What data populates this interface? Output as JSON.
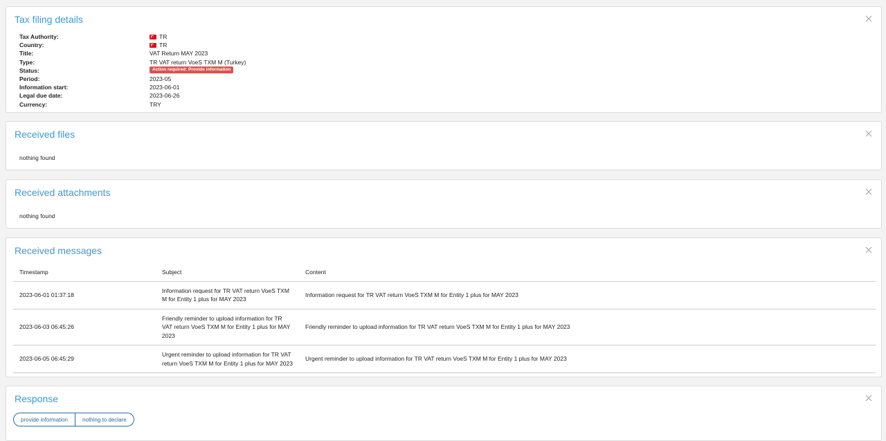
{
  "tax_filing": {
    "title": "Tax filing details",
    "rows": [
      {
        "label": "Tax Authority:",
        "value": "TR",
        "flag": true
      },
      {
        "label": "Country:",
        "value": "TR",
        "flag": true
      },
      {
        "label": "Title:",
        "value": "VAT Return MAY 2023"
      },
      {
        "label": "Type:",
        "value": "TR VAT return VoeS TXM M (Turkey)"
      },
      {
        "label": "Status:",
        "value": "Action required: Provide information",
        "badge": true
      },
      {
        "label": "Period:",
        "value": "2023-05"
      },
      {
        "label": "Information start:",
        "value": "2023-06-01"
      },
      {
        "label": "Legal due date:",
        "value": "2023-06-26"
      },
      {
        "label": "Currency:",
        "value": "TRY"
      }
    ]
  },
  "received_files": {
    "title": "Received files",
    "empty_text": "nothing found"
  },
  "received_attachments": {
    "title": "Received attachments",
    "empty_text": "nothing found"
  },
  "received_messages": {
    "title": "Received messages",
    "columns": [
      "Timestamp",
      "Subject",
      "Content"
    ],
    "rows": [
      [
        "2023-06-01 01:37:18",
        "Information request for TR VAT return VoeS TXM M for Entity 1 plus for MAY 2023",
        "Information request for TR VAT return VoeS TXM M for Entity 1 plus for MAY 2023"
      ],
      [
        "2023-06-03 06:45:26",
        "Friendly reminder to upload information for TR VAT return VoeS TXM M for Entity 1 plus for MAY 2023",
        "Friendly reminder to upload information for TR VAT return VoeS TXM M for Entity 1 plus for MAY 2023"
      ],
      [
        "2023-06-05 06:45:29",
        "Urgent reminder to upload information for TR VAT return VoeS TXM M for Entity 1 plus for MAY 2023",
        "Urgent reminder to upload information for TR VAT return VoeS TXM M for Entity 1 plus for MAY 2023"
      ]
    ]
  },
  "response": {
    "title": "Response",
    "provide_label": "provide information",
    "nothing_label": "nothing to declare"
  },
  "colors": {
    "accent": "#3a9ad9",
    "badge": "#d9534f",
    "button": "#2a6a9e"
  },
  "icons": {
    "close": "close-icon",
    "flag": "turkey-flag-icon"
  }
}
